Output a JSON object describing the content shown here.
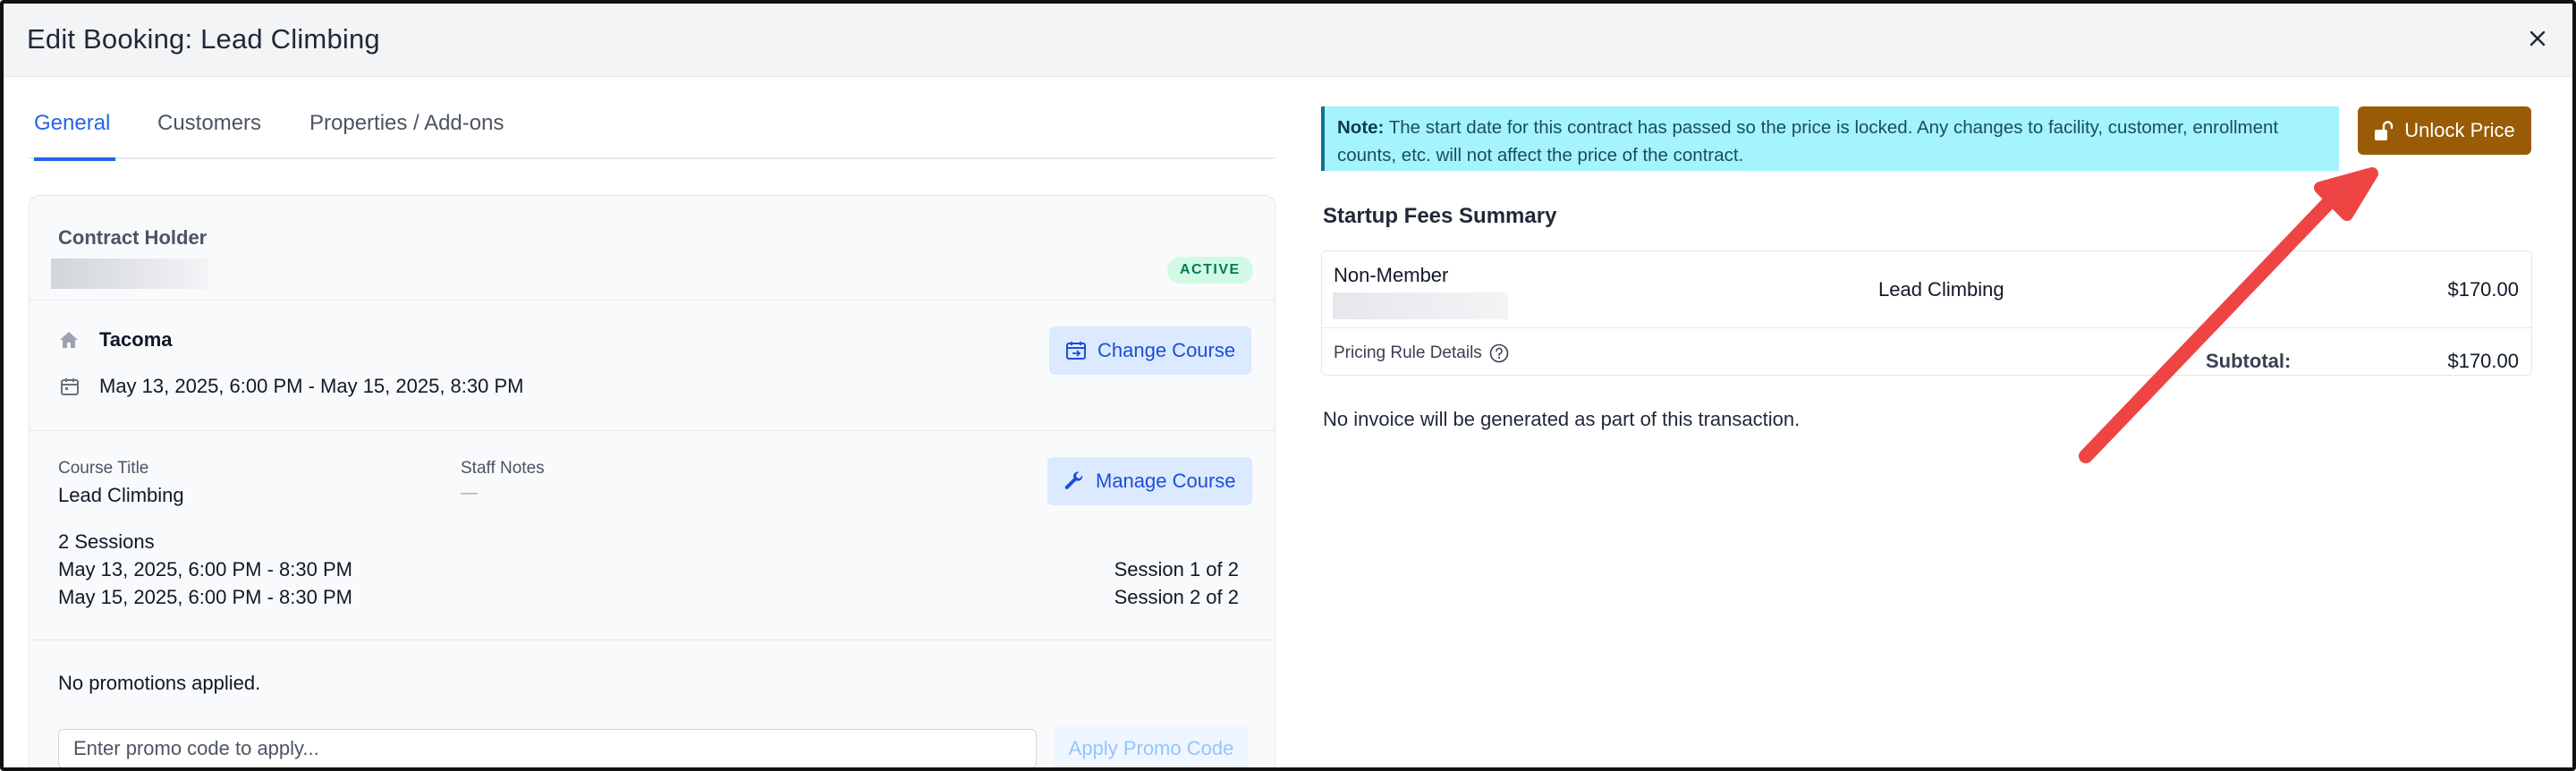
{
  "modal": {
    "title": "Edit Booking: Lead Climbing",
    "close_icon": "close-icon"
  },
  "tabs": [
    {
      "label": "General",
      "active": true
    },
    {
      "label": "Customers",
      "active": false
    },
    {
      "label": "Properties / Add-ons",
      "active": false
    }
  ],
  "contract": {
    "holder_label": "Contract Holder",
    "status": "ACTIVE"
  },
  "facility": {
    "location": "Tacoma",
    "date_range": "May 13, 2025, 6:00 PM - May 15, 2025, 8:30 PM",
    "change_course_label": "Change Course",
    "home_icon": "home-icon",
    "calendar_icon": "calendar-icon"
  },
  "course": {
    "title_label": "Course Title",
    "title_value": "Lead Climbing",
    "staff_notes_label": "Staff Notes",
    "staff_notes_value": "—",
    "manage_course_label": "Manage Course",
    "wrench_icon": "wrench-icon",
    "sessions_heading": "2 Sessions",
    "sessions": [
      {
        "date": "May 13, 2025, 6:00 PM - 8:30 PM",
        "label": "Session 1 of 2"
      },
      {
        "date": "May 15, 2025, 6:00 PM - 8:30 PM",
        "label": "Session 2 of 2"
      }
    ]
  },
  "promo": {
    "status": "No promotions applied.",
    "placeholder": "Enter promo code to apply...",
    "apply_label": "Apply Promo Code"
  },
  "note": {
    "prefix": "Note:",
    "text": " The start date for this contract has passed so the price is locked. Any changes to facility, customer, enrollment counts, etc. will not affect the price of the contract."
  },
  "unlock": {
    "label": "Unlock Price",
    "icon": "unlock-icon"
  },
  "fees": {
    "heading": "Startup Fees Summary",
    "rate_name": "Non-Member",
    "course": "Lead Climbing",
    "amount": "$170.00",
    "pricing_rule_label": "Pricing Rule Details",
    "help_icon": "help-circle-icon",
    "subtotal_label": "Subtotal:",
    "subtotal_value": "$170.00"
  },
  "footer": {
    "invoice_note": "No invoice will be generated as part of this transaction."
  },
  "colors": {
    "accent": "#2563eb",
    "unlock_button": "#9a5b07",
    "note_bg": "#a5f3fc",
    "annotation_arrow": "#ef4444",
    "active_badge_bg": "#d1fae5"
  }
}
